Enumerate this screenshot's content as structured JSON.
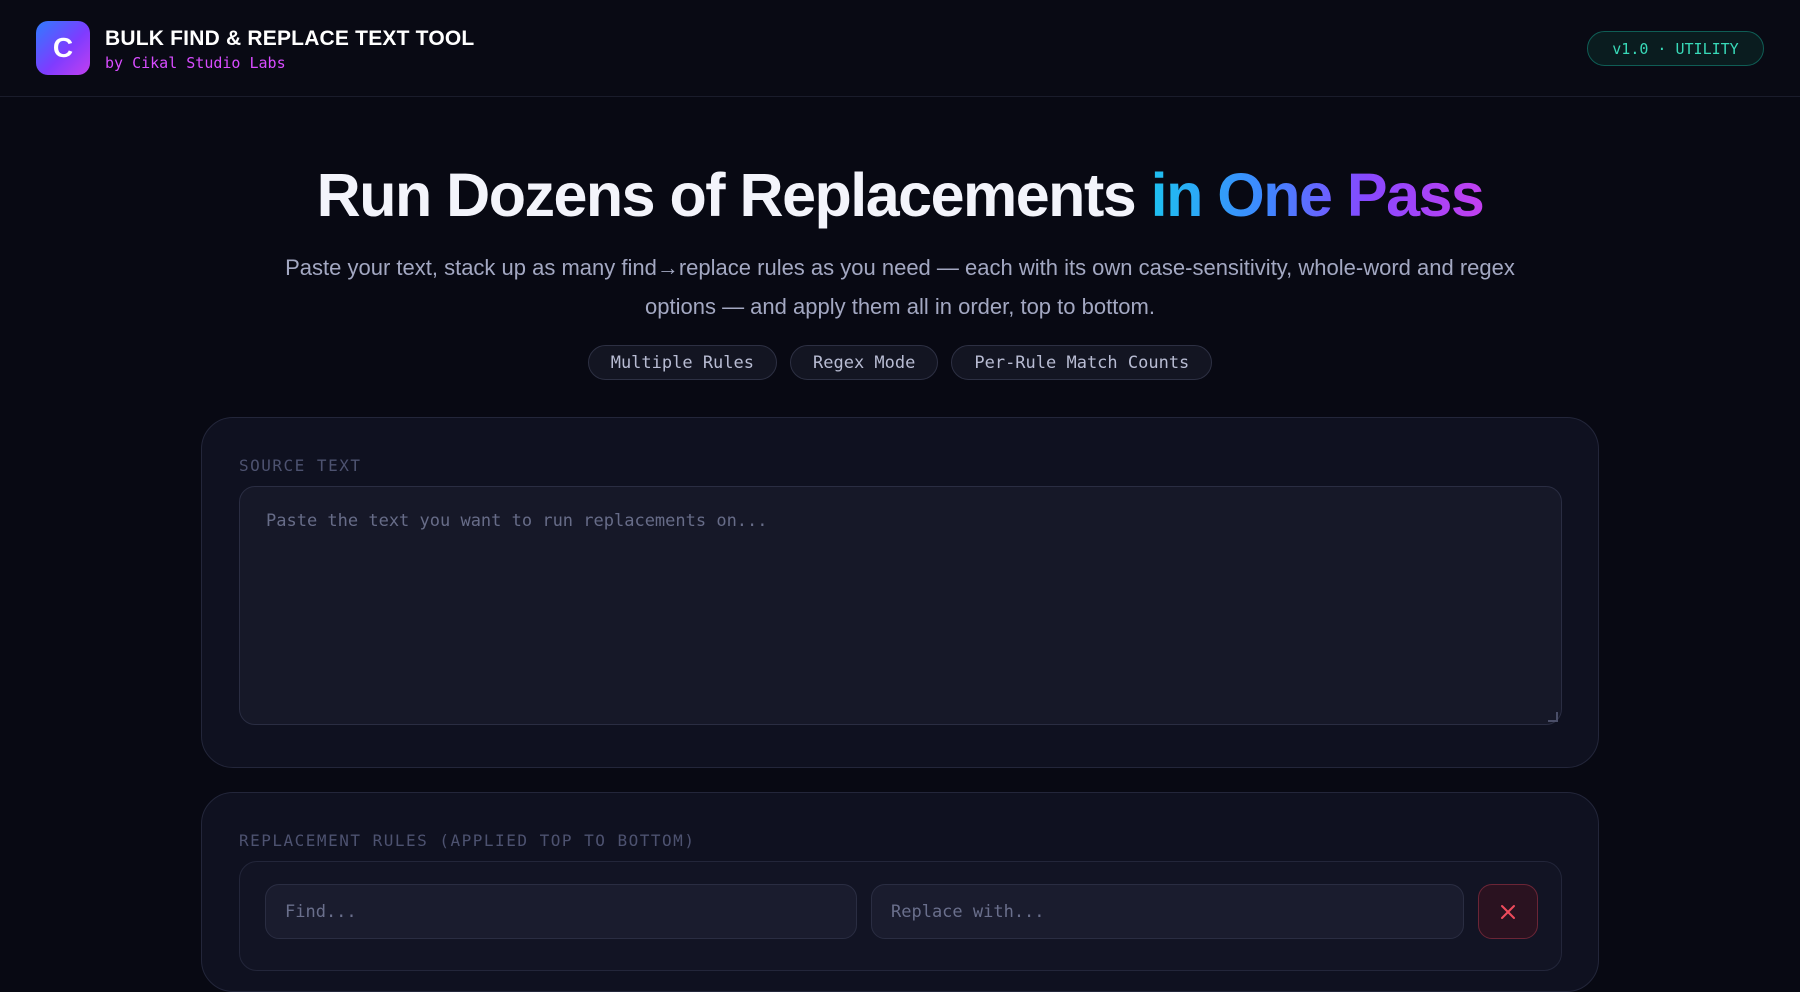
{
  "header": {
    "logo_letter": "C",
    "title": "BULK FIND & REPLACE TEXT TOOL",
    "subtitle": "by Cikal Studio Labs",
    "version_badge": "v1.0 · UTILITY"
  },
  "hero": {
    "title_plain": "Run Dozens of Replacements ",
    "title_highlight": "in One Pass",
    "description": "Paste your text, stack up as many find→replace rules as you need — each with its own case-sensitivity, whole-word and regex options — and apply them all in order, top to bottom.",
    "chips": [
      "Multiple Rules",
      "Regex Mode",
      "Per-Rule Match Counts"
    ]
  },
  "source": {
    "label": "SOURCE TEXT",
    "value": "",
    "placeholder": "Paste the text you want to run replacements on..."
  },
  "rules": {
    "label": "REPLACEMENT RULES (APPLIED TOP TO BOTTOM)",
    "items": [
      {
        "find_value": "",
        "find_placeholder": "Find...",
        "replace_value": "",
        "replace_placeholder": "Replace with...",
        "remove_icon": "close-icon"
      }
    ]
  },
  "colors": {
    "background": "#080913",
    "accent_magenta": "#d84cff",
    "accent_teal": "#38d9b8",
    "danger": "#ef4b5c",
    "gradient_start": "#1ec0f0",
    "gradient_end": "#c23ff0"
  }
}
